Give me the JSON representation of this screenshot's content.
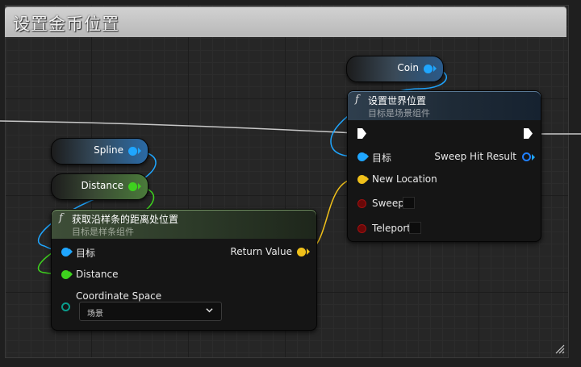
{
  "window": {
    "title": "设置金币位置"
  },
  "variables": {
    "coin": {
      "label": "Coin"
    },
    "spline": {
      "label": "Spline"
    },
    "distance": {
      "label": "Distance"
    }
  },
  "set_world_location_node": {
    "icon": "function-icon",
    "title": "设置世界位置",
    "subtitle": "目标是场景组件",
    "pins": {
      "target": "目标",
      "sweep_hit_result": "Sweep Hit Result",
      "new_location": "New Location",
      "sweep": "Sweep",
      "teleport": "Teleport"
    }
  },
  "get_location_node": {
    "icon": "function-icon",
    "title": "获取沿样条的距离处位置",
    "subtitle": "目标是样条组件",
    "pins": {
      "target": "目标",
      "return_value": "Return Value",
      "distance": "Distance",
      "coordinate_space": "Coordinate Space"
    },
    "coordinate_space_value": "场景"
  },
  "colors": {
    "object_pin": "#1fa6ff",
    "float_pin": "#3ed21e",
    "vector_pin": "#f0c01a",
    "bool_pin": "#8a0a0a",
    "exec_pin": "#ffffff"
  }
}
